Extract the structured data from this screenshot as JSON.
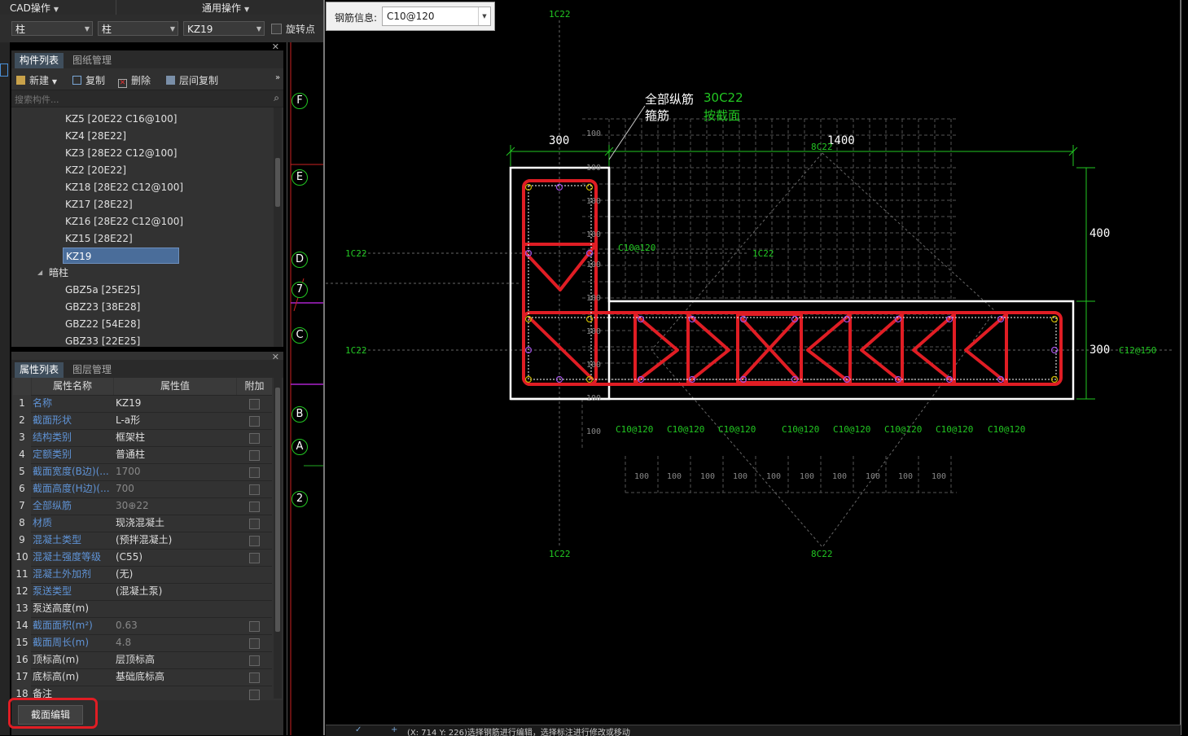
{
  "menus": {
    "cad_ops": "CAD操作",
    "general_ops": "通用操作"
  },
  "selectors": {
    "type1": "柱",
    "type2": "柱",
    "component": "KZ19",
    "rotate_label": "旋转点"
  },
  "component_panel": {
    "tabs": [
      "构件列表",
      "图纸管理"
    ],
    "buttons": {
      "new": "新建",
      "copy": "复制",
      "delete": "删除",
      "floor_copy": "层间复制"
    },
    "search_placeholder": "搜索构件...",
    "items": [
      "KZ5 [20E22 C16@100]",
      "KZ4 [28E22]",
      "KZ3 [28E22 C12@100]",
      "KZ2 [20E22]",
      "KZ18 [28E22 C12@100]",
      "KZ17 [28E22]",
      "KZ16 [28E22 C12@100]",
      "KZ15 [28E22]",
      "KZ19"
    ],
    "group": "暗柱",
    "group_items": [
      "GBZ5a [25E25]",
      "GBZ23 [38E28]",
      "GBZ22 [54E28]",
      "GBZ33 [22E25]"
    ]
  },
  "property_panel": {
    "tabs": [
      "属性列表",
      "图层管理"
    ],
    "headers": {
      "name": "属性名称",
      "value": "属性值",
      "extra": "附加"
    },
    "rows": [
      {
        "no": "1",
        "name": "名称",
        "value": "KZ19"
      },
      {
        "no": "2",
        "name": "截面形状",
        "value": "L-a形"
      },
      {
        "no": "3",
        "name": "结构类别",
        "value": "框架柱"
      },
      {
        "no": "4",
        "name": "定额类别",
        "value": "普通柱"
      },
      {
        "no": "5",
        "name": "截面宽度(B边)(...",
        "value": "1700"
      },
      {
        "no": "6",
        "name": "截面高度(H边)(...",
        "value": "700"
      },
      {
        "no": "7",
        "name": "全部纵筋",
        "value": "30⊕22"
      },
      {
        "no": "8",
        "name": "材质",
        "value": "现浇混凝土"
      },
      {
        "no": "9",
        "name": "混凝土类型",
        "value": "(预拌混凝土)"
      },
      {
        "no": "10",
        "name": "混凝土强度等级",
        "value": "(C55)"
      },
      {
        "no": "11",
        "name": "混凝土外加剂",
        "value": "(无)"
      },
      {
        "no": "12",
        "name": "泵送类型",
        "value": "(混凝土泵)"
      },
      {
        "no": "13",
        "name": "泵送高度(m)",
        "value": ""
      },
      {
        "no": "14",
        "name": "截面面积(m²)",
        "value": "0.63"
      },
      {
        "no": "15",
        "name": "截面周长(m)",
        "value": "4.8"
      },
      {
        "no": "16",
        "name": "顶标高(m)",
        "value": "层顶标高"
      },
      {
        "no": "17",
        "name": "底标高(m)",
        "value": "基础底标高"
      },
      {
        "no": "18",
        "name": "备注",
        "value": ""
      }
    ],
    "section_edit": "截面编辑"
  },
  "axis_labels": [
    "F",
    "E",
    "D",
    "7",
    "C",
    "B",
    "A",
    "2"
  ],
  "rebar_info": {
    "label": "钢筋信息:",
    "value": "C10@120"
  },
  "drawing": {
    "all_rebar_label": "全部纵筋",
    "all_rebar_value": "30C22",
    "stirrup_label": "箍筋",
    "stirrup_value": "按截面",
    "dim_300": "300",
    "dim_1400": "1400",
    "dim_400": "400",
    "dim_300_right": "300",
    "top_1c22": "1C22",
    "bottom_1c22": "1C22",
    "top_8c22": "8C22",
    "bottom_8c22": "8C22",
    "left_1c22_a": "1C22",
    "left_1c22_b": "1C22",
    "mid_1c22": "1C22",
    "c10_top": "C10@120",
    "c12": "C12@150",
    "stirrups_bottom": [
      "C10@120",
      "C10@120",
      "C10@120",
      "C10@120",
      "C10@120",
      "C10@120",
      "C10@120",
      "C10@120"
    ],
    "grid_100": "100"
  },
  "status_text": "(X: 714 Y: 226)选择钢筋进行编辑，选择标注进行修改或移动",
  "colors": {
    "rebar": "#e01d24",
    "green": "#22c722",
    "white": "#ffffff"
  }
}
